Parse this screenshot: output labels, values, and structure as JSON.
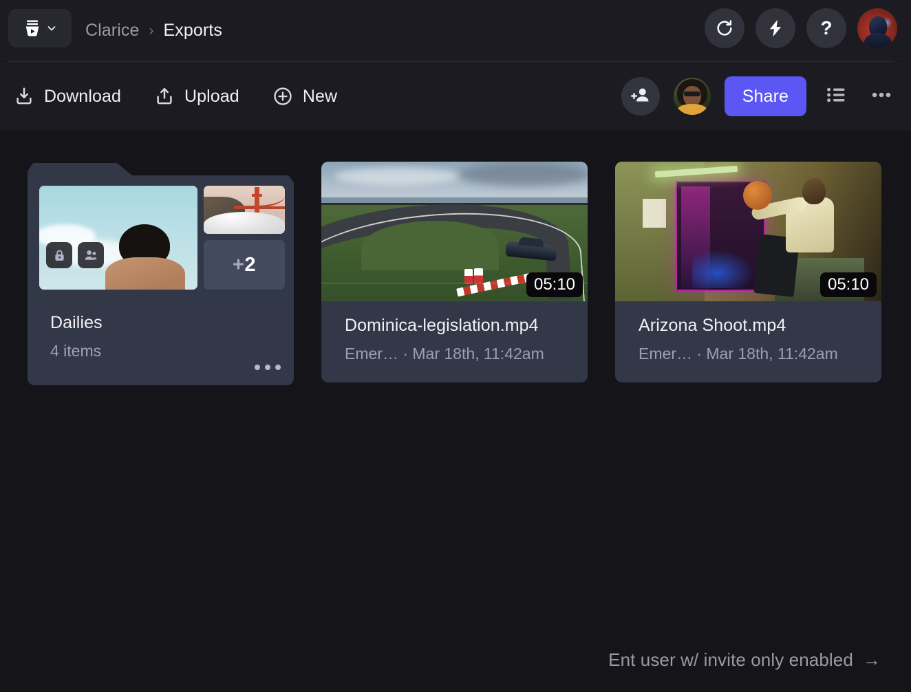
{
  "app": {
    "logo_icon": "frameio-bucket-play-icon",
    "logo_caret_icon": "chevron-down-icon"
  },
  "breadcrumb": {
    "root": "Clarice",
    "separator": "›",
    "current": "Exports"
  },
  "topbar": {
    "actions": [
      {
        "name": "refresh-button",
        "icon": "refresh-icon"
      },
      {
        "name": "lightning-button",
        "icon": "lightning-bolt-icon"
      },
      {
        "name": "help-button",
        "icon": "question-mark-icon",
        "label": "?"
      }
    ],
    "avatar": {
      "name": "user-avatar",
      "icon": "avatar-icon"
    }
  },
  "toolbar": {
    "download_label": "Download",
    "download_icon": "download-icon",
    "upload_label": "Upload",
    "upload_icon": "upload-icon",
    "new_label": "New",
    "new_icon": "plus-circle-icon",
    "add_person_icon": "add-person-icon",
    "collaborator_avatar": "collaborator-avatar",
    "share_label": "Share",
    "share_color": "#5c56f4",
    "list_view_icon": "list-view-icon",
    "more_icon": "more-horizontal-icon"
  },
  "items": [
    {
      "type": "folder",
      "name": "Dailies",
      "count": "4 items",
      "extra_thumbs_label": "+2",
      "extra_thumbs_plus": "+",
      "extra_thumbs_number": "2",
      "badges": [
        "lock-icon",
        "people-icon"
      ],
      "more_icon": "more-horizontal-icon"
    },
    {
      "type": "video",
      "name": "Dominica-legislation.mp4",
      "meta": "Emer… · Mar 18th, 11:42am",
      "duration": "05:10"
    },
    {
      "type": "video",
      "name": "Arizona Shoot.mp4",
      "meta": "Emer… · Mar 18th, 11:42am",
      "duration": "05:10"
    }
  ],
  "footer": {
    "note": "Ent user w/ invite only enabled",
    "arrow": "→"
  },
  "colors": {
    "page_bg": "#141419",
    "chrome_bg": "#1b1b21",
    "card_bg": "#333848",
    "accent": "#5c56f4"
  }
}
